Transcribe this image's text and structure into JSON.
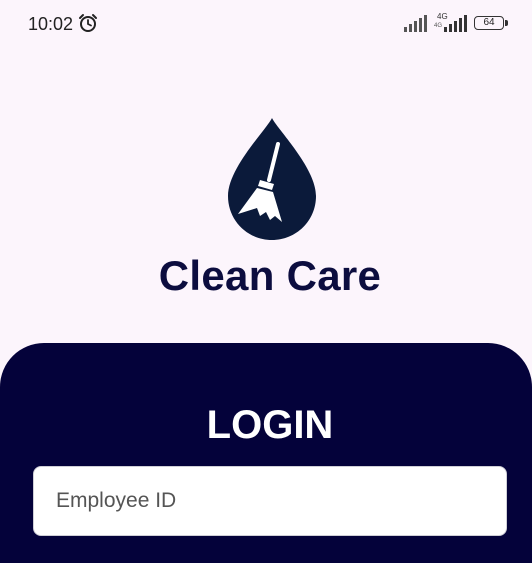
{
  "status_bar": {
    "time": "10:02",
    "network_type": "4G",
    "network_sub": "4G",
    "battery_level": "64",
    "icons": [
      "alarm-icon",
      "signal-icon",
      "signal-icon",
      "battery-icon"
    ]
  },
  "app": {
    "name": "Clean Care",
    "logo_icon": "water-drop-broom-icon",
    "brand_color": "#0c0d3f"
  },
  "login": {
    "title": "LOGIN",
    "employee_id": {
      "placeholder": "Employee ID",
      "value": ""
    },
    "panel_color": "#04023a"
  }
}
